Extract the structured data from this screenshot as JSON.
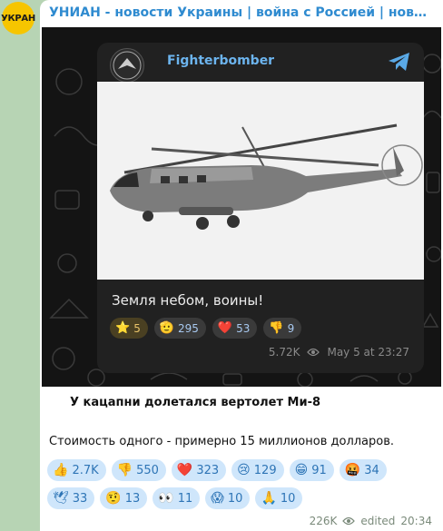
{
  "channel": {
    "avatar_text": "УКРАН",
    "title": "УНИАН - новости Украины | война с Россией | новини Украї..."
  },
  "forward": {
    "name": "Fighterbomber",
    "caption": "Земля небом, воины!",
    "reactions": [
      {
        "icon": "star-icon",
        "emoji": "⭐",
        "count": "5"
      },
      {
        "icon": "salute-icon",
        "emoji": "🫡",
        "count": "295"
      },
      {
        "icon": "heart-icon",
        "emoji": "❤️",
        "count": "53"
      },
      {
        "icon": "thumbs-down-icon",
        "emoji": "👎",
        "count": "9"
      }
    ],
    "views": "5.72K",
    "date": "May 5 at 23:27"
  },
  "message": {
    "headline": "У кацапни долетался вертолет Ми-8",
    "body": "Стоимость одного - примерно 15 миллионов долларов.",
    "reactions_row1": [
      {
        "icon": "thumbs-up-icon",
        "emoji": "👍",
        "count": "2.7K"
      },
      {
        "icon": "thumbs-down-icon",
        "emoji": "👎",
        "count": "550"
      },
      {
        "icon": "heart-icon",
        "emoji": "❤️",
        "count": "323"
      },
      {
        "icon": "crying-face-icon",
        "emoji": "😢",
        "count": "129"
      },
      {
        "icon": "grinning-face-icon",
        "emoji": "😁",
        "count": "91"
      },
      {
        "icon": "angry-face-icon",
        "emoji": "🤬",
        "count": "34"
      }
    ],
    "reactions_row2": [
      {
        "icon": "dove-icon",
        "emoji": "🕊",
        "count": "33"
      },
      {
        "icon": "confused-face-icon",
        "emoji": "🤨",
        "count": "13"
      },
      {
        "icon": "eyes-icon",
        "emoji": "👀",
        "count": "11"
      },
      {
        "icon": "screaming-face-icon",
        "emoji": "😱",
        "count": "10"
      },
      {
        "icon": "praying-hands-icon",
        "emoji": "🙏",
        "count": "10"
      }
    ],
    "views": "226K",
    "edited": "edited",
    "time": "20:34"
  }
}
